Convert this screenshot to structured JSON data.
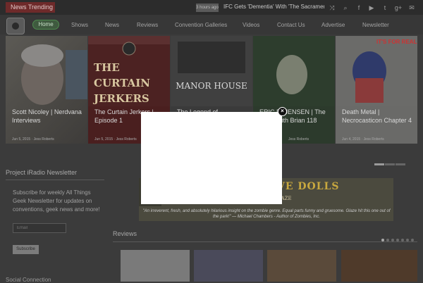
{
  "topbar": {
    "trending_label": "News Trending",
    "time": "3 hours ago",
    "headline": "IFC Gets 'Dementia' With 'The Sacrament' A",
    "icons": [
      "shuffle-icon",
      "search-icon",
      "facebook-icon",
      "youtube-icon",
      "twitter-icon",
      "google-plus-icon",
      "mail-icon"
    ]
  },
  "nav": {
    "items": [
      "Home",
      "Shows",
      "News",
      "Reviews",
      "Convention Galleries",
      "Videos",
      "Contact Us",
      "Advertise",
      "Newsletter"
    ]
  },
  "slider": {
    "cards": [
      {
        "caption": "Scott Nicoley | Nerdvana Interviews",
        "date": "Jun 5, 2015",
        "author": "Jess Roberts",
        "overlay": ""
      },
      {
        "caption": "The Curtain Jerkers | Episode 1",
        "date": "Jun 5, 2015",
        "author": "Jess Roberts",
        "overlay": "THE CURTAIN JERKERS"
      },
      {
        "caption": "The Legend of",
        "date": "",
        "author": "",
        "overlay": "MANOR HOUSE"
      },
      {
        "caption": "ERIC D. JENSEN | The Show with Brian 118",
        "date": "",
        "author": "Jess Roberts",
        "overlay": ""
      },
      {
        "caption": "Death Metal | Necrocasticon Chapter 4",
        "date": "Jun 4, 2015",
        "author": "Jess Roberts",
        "overlay": "IT'S FOR REAL"
      }
    ]
  },
  "sidebar": {
    "newsletter_title": "Project iRadio Newsletter",
    "newsletter_text": "Subscribe for weekly All Things Geek Newsletter for updates on conventions, geek news and more!",
    "email_placeholder": "Email",
    "subscribe_label": "Subscribe",
    "social_title": "Social Connection"
  },
  "ad": {
    "title": "TABLE LOVE DOLLS",
    "author": "J.H. GLAZE",
    "quote": "\"An irreverent, fresh, and absolutely hilarious insight on the zombie genre. Equal parts funny and gruesome. Glaze hit this one out of the park!\" — Michael Chambers - Author of Zombies, Inc."
  },
  "reviews": {
    "title": "Reviews"
  },
  "modal": {
    "close_glyph": "×"
  },
  "colors": {
    "trending": "#6e2a2a",
    "home_active": "#4e8a4e",
    "ad_title": "#c8a83f"
  }
}
